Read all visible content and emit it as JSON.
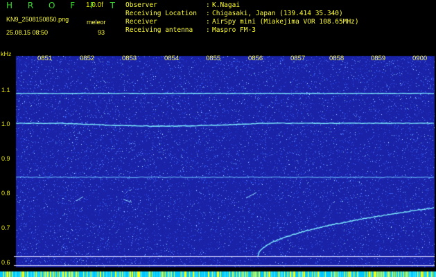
{
  "header": {
    "title": "H R O F F T",
    "version": "1.0.0f",
    "filename": "KN9_2508150850.png",
    "mode": "meleor",
    "datetime": "25.08.15 08:50",
    "count": "93",
    "info": [
      {
        "label": "Observer",
        "value": "K.Nagai"
      },
      {
        "label": "Receiving Location",
        "value": "Chigasaki, Japan (139.414 35.340)"
      },
      {
        "label": "Receiver",
        "value": "AirSpy mini (Miakejima VOR 108.65MHz)"
      },
      {
        "label": "Receiving antenna",
        "value": "Maspro FM-3"
      }
    ]
  },
  "spectrogram": {
    "y_unit": "kHz",
    "y_ticks": [
      "1.1",
      "1.0",
      "0.9",
      "0.8",
      "0.7",
      "0.6"
    ],
    "x_ticks": [
      "0851",
      "0852",
      "0853",
      "0854",
      "0855",
      "0856",
      "0857",
      "0858",
      "0859",
      "0900"
    ],
    "colors": {
      "background": "#1a22a8",
      "noise": "#2b5cff",
      "trace": "#7ff0ff",
      "label": "#ffff30"
    }
  }
}
